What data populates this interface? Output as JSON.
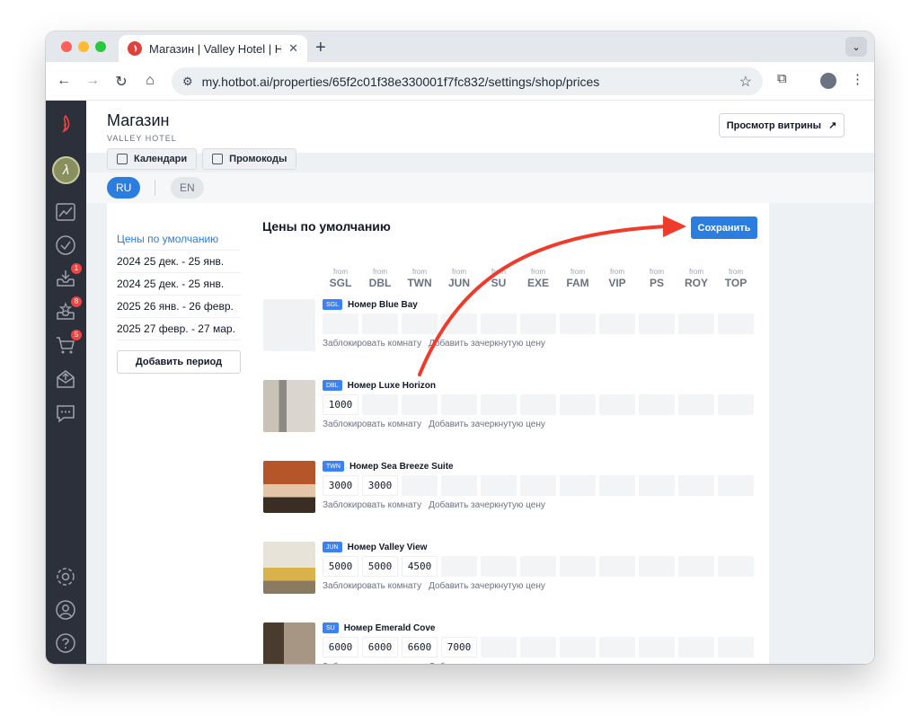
{
  "browser": {
    "tab_title": "Магазин | Valley Hotel | Hotbot",
    "url": "my.hotbot.ai/properties/65f2c01f38e330001f7fc832/settings/shop/prices"
  },
  "header": {
    "title": "Магазин",
    "subtitle": "VALLEY HOTEL",
    "storefront_label": "Просмотр витрины"
  },
  "subtabs": [
    {
      "label": "Календари"
    },
    {
      "label": "Промокоды"
    }
  ],
  "languages": [
    {
      "label": "RU",
      "active": true
    },
    {
      "label": "EN",
      "active": false
    }
  ],
  "periods": {
    "items": [
      {
        "label": "Цены по умолчанию",
        "active": true
      },
      {
        "label": "2024 25 дек. - 25 янв."
      },
      {
        "label": "2024 25 дек. - 25 янв."
      },
      {
        "label": "2025 26 янв. - 26 февр."
      },
      {
        "label": "2025 27 февр. - 27 мар."
      }
    ],
    "add_label": "Добавить период"
  },
  "prices": {
    "title": "Цены по умолчанию",
    "save_label": "Сохранить",
    "from_label": "from",
    "columns": [
      "SGL",
      "DBL",
      "TWN",
      "JUN",
      "SU",
      "EXE",
      "FAM",
      "VIP",
      "PS",
      "ROY",
      "TOP"
    ]
  },
  "rooms": [
    {
      "code": "SGL",
      "name": "Номер Blue Bay",
      "values": [
        "",
        "",
        "",
        "",
        "",
        "",
        "",
        "",
        "",
        "",
        ""
      ]
    },
    {
      "code": "DBL",
      "name": "Номер Luxe Horizon",
      "values": [
        "1000",
        "",
        "",
        "",
        "",
        "",
        "",
        "",
        "",
        "",
        ""
      ]
    },
    {
      "code": "TWN",
      "name": "Номер Sea Breeze Suite",
      "values": [
        "3000",
        "3000",
        "",
        "",
        "",
        "",
        "",
        "",
        "",
        "",
        ""
      ]
    },
    {
      "code": "JUN",
      "name": "Номер Valley View",
      "values": [
        "5000",
        "5000",
        "4500",
        "",
        "",
        "",
        "",
        "",
        "",
        "",
        ""
      ]
    },
    {
      "code": "SU",
      "name": "Номер Emerald Cove",
      "values": [
        "6000",
        "6000",
        "6600",
        "7000",
        "",
        "",
        "",
        "",
        "",
        "",
        ""
      ]
    }
  ],
  "room_actions": {
    "block": "Заблокировать комнату",
    "strike": "Добавить зачеркнутую цену"
  },
  "rail_badges": {
    "inbox": "1",
    "reviews": "8",
    "cart": "5"
  },
  "colors": {
    "accent": "#2b7de0",
    "rail": "#2b303a",
    "annotation_arrow": "#f03a2a",
    "badge": "#ef4444"
  }
}
